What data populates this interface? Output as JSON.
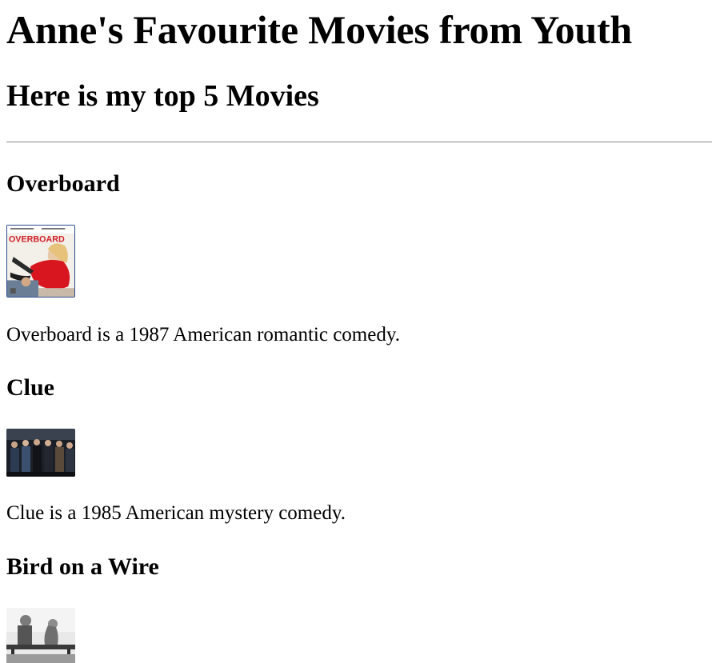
{
  "page": {
    "title": "Anne's Favourite Movies from Youth",
    "subtitle": "Here is my top 5 Movies"
  },
  "movies": [
    {
      "title": "Overboard",
      "poster_text": "OVERBOARD",
      "description": "Overboard is a 1987 American romantic comedy."
    },
    {
      "title": "Clue",
      "description": "Clue is a 1985 American mystery comedy."
    },
    {
      "title": "Bird on a Wire",
      "description": ""
    }
  ]
}
